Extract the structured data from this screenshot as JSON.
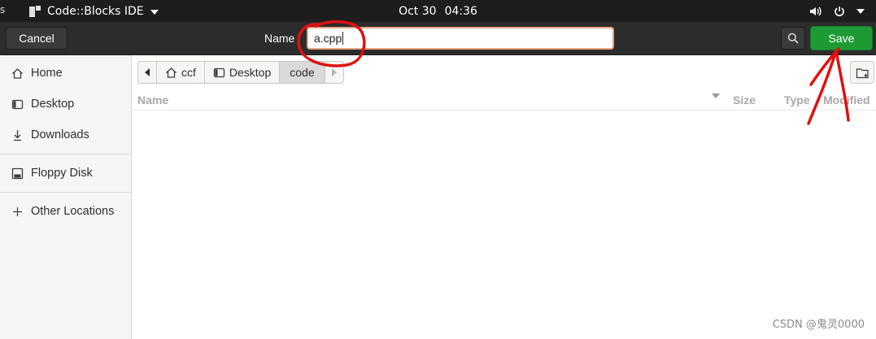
{
  "topbar": {
    "activities_fragment": "s",
    "app_title": "Code::Blocks IDE",
    "date": "Oct 30",
    "time": "04:36"
  },
  "header": {
    "cancel_label": "Cancel",
    "name_label": "Name",
    "name_value": "a.cpp",
    "save_label": "Save"
  },
  "sidebar": {
    "items": [
      {
        "label": "Home",
        "icon": "home-icon"
      },
      {
        "label": "Desktop",
        "icon": "desktop-icon"
      },
      {
        "label": "Downloads",
        "icon": "download-icon"
      },
      {
        "label": "Floppy Disk",
        "icon": "floppy-disk-icon"
      },
      {
        "label": "Other Locations",
        "icon": "plus-icon"
      }
    ]
  },
  "pathbar": {
    "segments": [
      "ccf",
      "Desktop",
      "code"
    ],
    "active": "code"
  },
  "file_list": {
    "columns": [
      "Name",
      "Size",
      "Type",
      "Modified"
    ],
    "rows": []
  },
  "watermark": "CSDN @鬼灵0000",
  "colors": {
    "topbar_bg": "#1d1d1d",
    "header_bg": "#2c2c2c",
    "save_green": "#1e9a35",
    "input_focus": "#e9a482",
    "annotation_red": "#e01010"
  }
}
